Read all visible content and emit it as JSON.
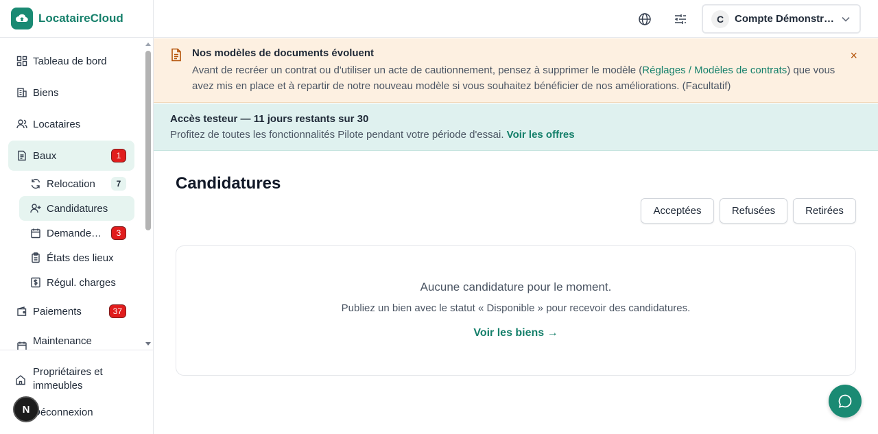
{
  "app": {
    "name": "LocataireCloud"
  },
  "sidebar": {
    "items": [
      {
        "label": "Tableau de bord",
        "icon": "dashboard-icon"
      },
      {
        "label": "Biens",
        "icon": "building-icon"
      },
      {
        "label": "Locataires",
        "icon": "users-icon"
      },
      {
        "label": "Baux",
        "icon": "document-icon",
        "badge": "1"
      },
      {
        "label": "Paiements",
        "icon": "wallet-icon",
        "badge": "37"
      },
      {
        "label": "Maintenance",
        "icon": "calendar-icon"
      }
    ],
    "subitems": [
      {
        "label": "Relocation",
        "icon": "refresh-icon",
        "badge": "7"
      },
      {
        "label": "Candidatures",
        "icon": "user-plus-icon"
      },
      {
        "label": "Demande…",
        "icon": "calendar-icon",
        "badge": "3"
      },
      {
        "label": "États des lieux",
        "icon": "clipboard-icon"
      },
      {
        "label": "Régul. charges",
        "icon": "dollar-icon"
      }
    ],
    "bottom": {
      "owners_label": "Propriétaires et immeubles",
      "logout_label": "Déconnexion",
      "avatar_letter": "N"
    }
  },
  "header": {
    "account_initial": "C",
    "account_name": "Compte Démonstration"
  },
  "banner_warning": {
    "title": "Nos modèles de documents évoluent",
    "text_before": "Avant de recréer un contrat ou d'utiliser un acte de cautionnement, pensez à supprimer le modèle (",
    "link": "Réglages / Modèles de contrats",
    "text_after": ") que vous avez mis en place et à repartir de notre nouveau modèle si vous souhaitez bénéficier de nos améliorations. (Facultatif)",
    "close": "×"
  },
  "banner_trial": {
    "title": "Accès testeur — 11 jours restants sur 30",
    "text": "Profitez de toutes les fonctionnalités Pilote pendant votre période d'essai.",
    "link": "Voir les offres"
  },
  "main": {
    "title": "Candidatures",
    "filters": [
      "Acceptées",
      "Refusées",
      "Retirées"
    ],
    "empty": {
      "title": "Aucune candidature pour le moment.",
      "subtitle": "Publiez un bien avec le statut « Disponible » pour recevoir des candidatures.",
      "link": "Voir les biens →"
    }
  },
  "colors": {
    "brand": "#1a8a73",
    "badge_red": "#e11d1d",
    "warning_bg": "#fdf0e1",
    "trial_bg": "#dff1ef"
  }
}
